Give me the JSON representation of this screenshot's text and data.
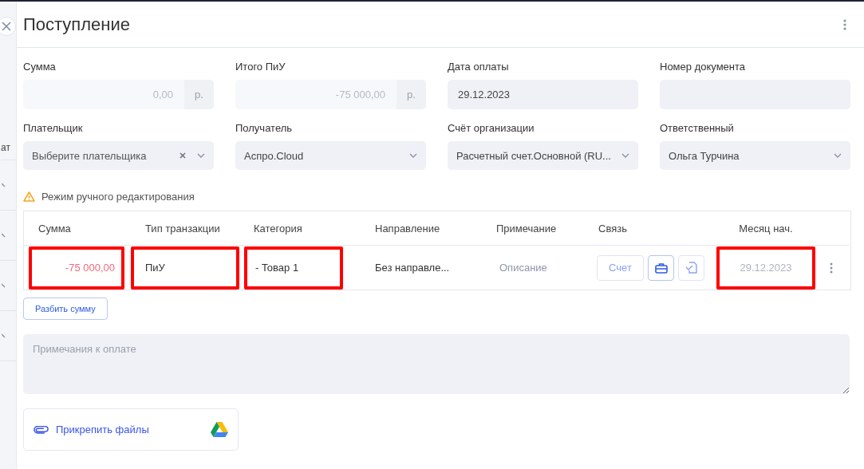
{
  "background_panel": {
    "fragment": "ат"
  },
  "dialog": {
    "title": "Поступление"
  },
  "fields": [
    {
      "label": "Сумма",
      "kind": "amount",
      "value": "0,00",
      "unit": "р.",
      "disabled": true
    },
    {
      "label": "Итого ПиУ",
      "kind": "amount",
      "value": "-75 000,00",
      "unit": "р.",
      "disabled": true
    },
    {
      "label": "Дата оплаты",
      "kind": "text",
      "value": "29.12.2023"
    },
    {
      "label": "Номер документа",
      "kind": "text"
    },
    {
      "label": "Плательщик",
      "kind": "select",
      "placeholder": "Выберите плательщика",
      "clearable": true
    },
    {
      "label": "Получатель",
      "kind": "select",
      "value": "Аспро.Cloud",
      "clearable": false
    },
    {
      "label": "Счёт организации",
      "kind": "select",
      "value": "Расчетный счет.Основной (RU...",
      "clearable": false
    },
    {
      "label": "Ответственный",
      "kind": "select",
      "value": "Ольга Турчина",
      "clearable": false
    }
  ],
  "notice": "Режим ручного редактирования",
  "table": {
    "columns": [
      "Сумма",
      "Тип транзакции",
      "Категория",
      "Направление",
      "Примечание",
      "Связь",
      "Месяц нач."
    ],
    "rows": [
      {
        "cells": [
          {
            "kind": "amount",
            "text": "-75 000,00",
            "highlighted": true
          },
          {
            "kind": "text",
            "text": "ПиУ",
            "highlighted": true
          },
          {
            "kind": "text",
            "text": "- Товар 1",
            "highlighted": true
          },
          {
            "kind": "text",
            "text": "Без направле...",
            "highlighted": false
          },
          {
            "kind": "placeholder",
            "text": "Описание",
            "highlighted": false
          },
          {
            "kind": "links",
            "highlighted": false,
            "buttons": [
              {
                "kind": "label",
                "label": "Счет"
              },
              {
                "kind": "briefcase"
              },
              {
                "kind": "document"
              }
            ]
          },
          {
            "kind": "date",
            "text": "29.12.2023",
            "highlighted": true
          }
        ]
      }
    ]
  },
  "split_button": "Разбить сумму",
  "notes": {
    "placeholder": "Примечания к оплате"
  },
  "attach": {
    "label": "Прикрепить файлы"
  }
}
